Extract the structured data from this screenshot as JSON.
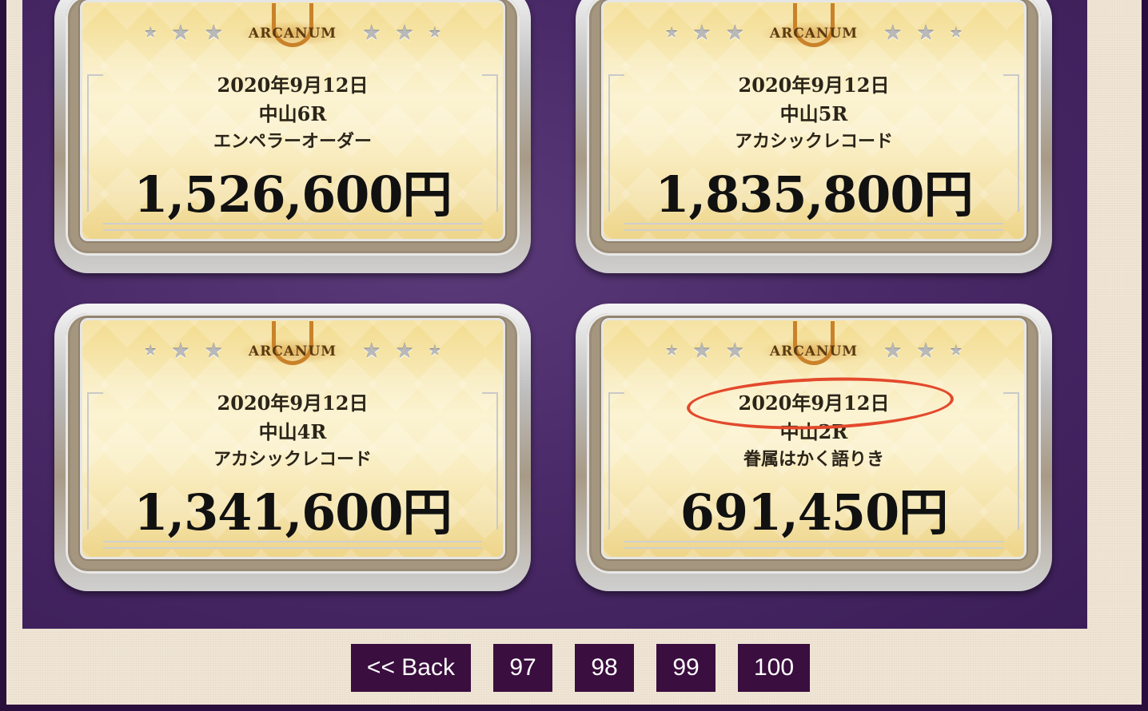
{
  "cards": [
    {
      "logo": "ARCANUM",
      "date": "2020年9月12日",
      "race": "中山6R",
      "name": "エンペラーオーダー",
      "amount": "1,526,600円"
    },
    {
      "logo": "ARCANUM",
      "date": "2020年9月12日",
      "race": "中山5R",
      "name": "アカシックレコード",
      "amount": "1,835,800円"
    },
    {
      "logo": "ARCANUM",
      "date": "2020年9月12日",
      "race": "中山4R",
      "name": "アカシックレコード",
      "amount": "1,341,600円"
    },
    {
      "logo": "ARCANUM",
      "date": "2020年9月12日",
      "race": "中山2R",
      "name": "眷属はかく語りき",
      "amount": "691,450円"
    }
  ],
  "pagination": {
    "back": "<< Back",
    "pages": [
      "97",
      "98",
      "99",
      "100"
    ]
  },
  "colors": {
    "highlight_circle": "#e3492c",
    "pager_bg": "#3a0e3f",
    "panel_bg": "#4a2a68"
  }
}
